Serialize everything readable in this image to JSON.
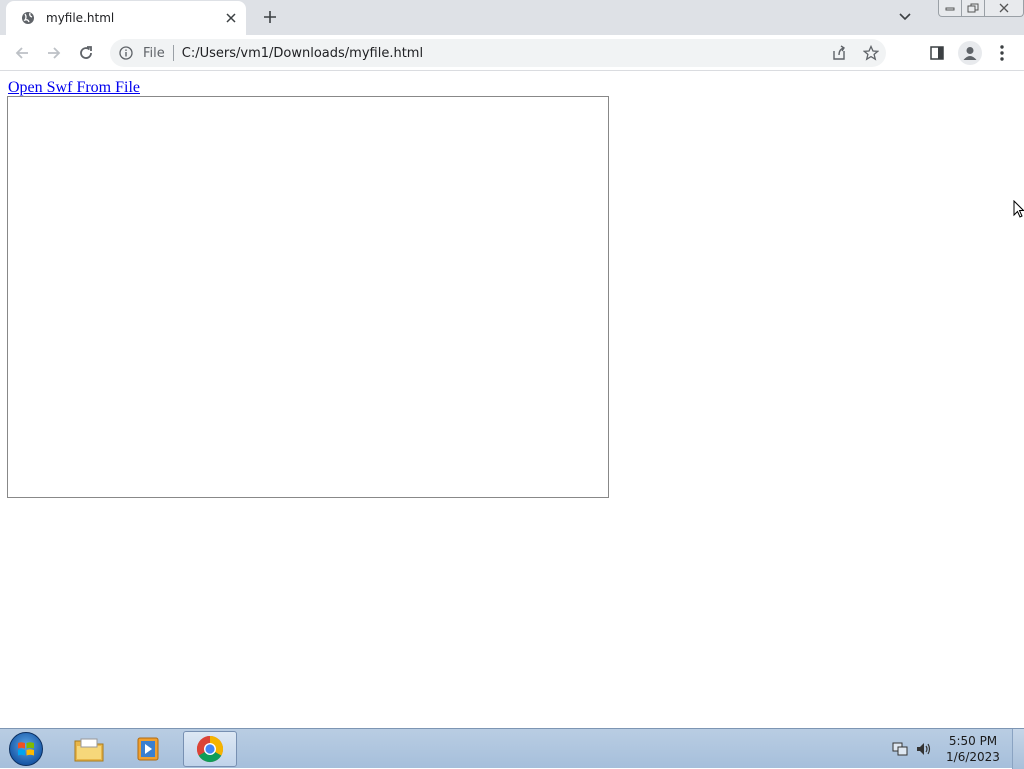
{
  "browser": {
    "tab": {
      "title": "myfile.html"
    },
    "omnibox": {
      "scheme_label": "File",
      "url": "C:/Users/vm1/Downloads/myfile.html"
    }
  },
  "page": {
    "link_text": "Open Swf From File"
  },
  "taskbar": {
    "apps": [
      "windows-explorer",
      "media-player",
      "google-chrome"
    ],
    "active_app": "google-chrome",
    "clock": {
      "time": "5:50 PM",
      "date": "1/6/2023"
    }
  },
  "colors": {
    "tabstrip": "#dee1e6",
    "link": "#0000ee",
    "taskbar": "#b9cde3"
  }
}
